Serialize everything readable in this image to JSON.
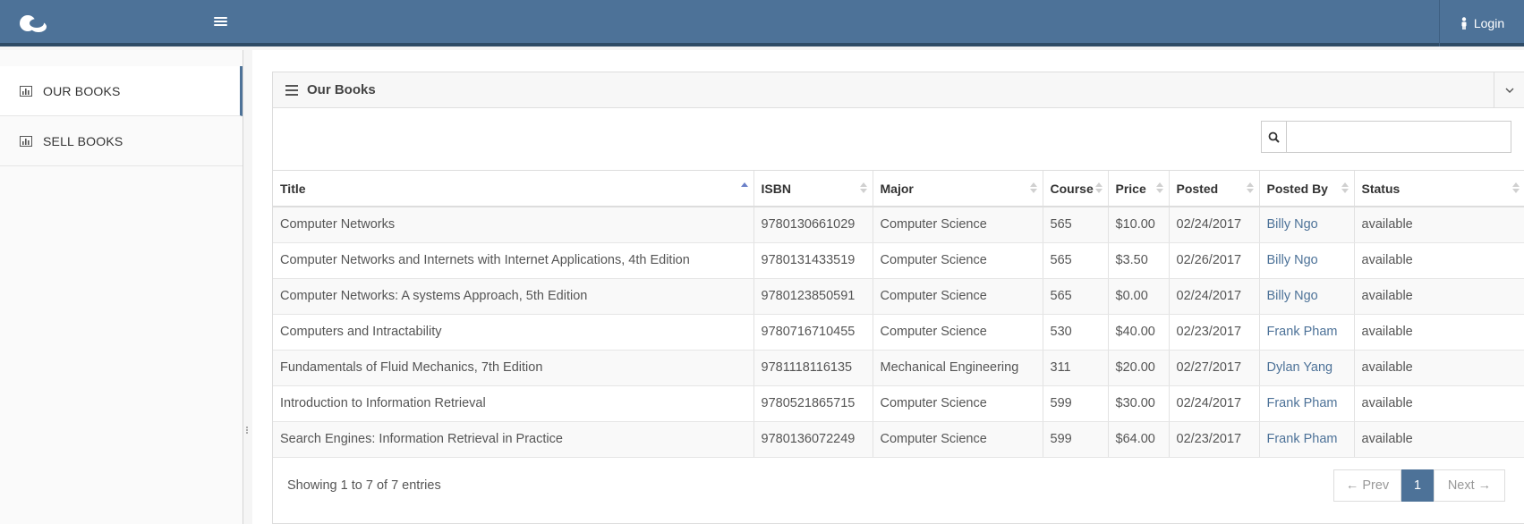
{
  "header": {
    "login_label": "Login"
  },
  "sidebar": {
    "items": [
      {
        "label": "OUR BOOKS",
        "active": true
      },
      {
        "label": "SELL BOOKS",
        "active": false
      }
    ]
  },
  "panel": {
    "title": "Our Books"
  },
  "search": {
    "value": "",
    "placeholder": ""
  },
  "table": {
    "columns": [
      "Title",
      "ISBN",
      "Major",
      "Course",
      "Price",
      "Posted",
      "Posted By",
      "Status"
    ],
    "rows": [
      [
        "Computer Networks",
        "9780130661029",
        "Computer Science",
        "565",
        "$10.00",
        "02/24/2017",
        "Billy Ngo",
        "available"
      ],
      [
        "Computer Networks and Internets with Internet Applications, 4th Edition",
        "9780131433519",
        "Computer Science",
        "565",
        "$3.50",
        "02/26/2017",
        "Billy Ngo",
        "available"
      ],
      [
        "Computer Networks: A systems Approach, 5th Edition",
        "9780123850591",
        "Computer Science",
        "565",
        "$0.00",
        "02/24/2017",
        "Billy Ngo",
        "available"
      ],
      [
        "Computers and Intractability",
        "9780716710455",
        "Computer Science",
        "530",
        "$40.00",
        "02/23/2017",
        "Frank Pham",
        "available"
      ],
      [
        "Fundamentals of Fluid Mechanics, 7th Edition",
        "9781118116135",
        "Mechanical Engineering",
        "311",
        "$20.00",
        "02/27/2017",
        "Dylan Yang",
        "available"
      ],
      [
        "Introduction to Information Retrieval",
        "9780521865715",
        "Computer Science",
        "599",
        "$30.00",
        "02/24/2017",
        "Frank Pham",
        "available"
      ],
      [
        "Search Engines: Information Retrieval in Practice",
        "9780136072249",
        "Computer Science",
        "599",
        "$64.00",
        "02/23/2017",
        "Frank Pham",
        "available"
      ]
    ]
  },
  "footer": {
    "showing": "Showing 1 to 7 of 7 entries",
    "prev": "← Prev",
    "current_page": "1",
    "next": "Next →"
  },
  "colors": {
    "accent": "#4d7298",
    "header_border": "#2e4b66",
    "link": "#4d7298"
  }
}
